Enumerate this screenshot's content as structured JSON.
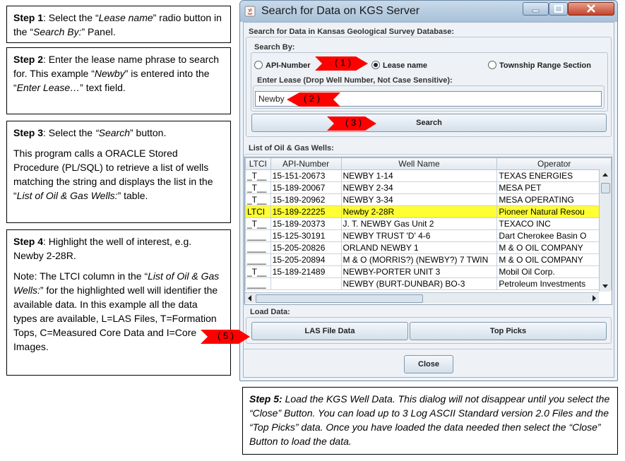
{
  "steps": {
    "s1": {
      "head": "Step 1",
      "text1": ": Select the “",
      "em1": "Lease name",
      "text2": "” radio button in the “",
      "em2": "Search By:",
      "text3": "” Panel."
    },
    "s2": {
      "head": "Step 2",
      "text1": ": Enter the lease name phrase to search for. This example “",
      "em1": "Newby",
      "text2": "” is entered into the “",
      "em2": "Enter Lease…",
      "text3": "” text field."
    },
    "s3": {
      "head": "Step 3",
      "text1": ": Select the ",
      "em1": "“Search",
      "text2": "” button.",
      "para2a": "This program calls a ORACLE Stored Procedure (PL/SQL) to retrieve a list of wells matching the string and displays the list in the “",
      "em2": "List of Oil & Gas Wells:",
      "para2b": "” table."
    },
    "s4": {
      "head": "Step 4",
      "text1": ": Highlight the well of interest, e.g. Newby 2-28R.",
      "para2a": "Note: The LTCI column in the “",
      "em2": "List of Oil & Gas Wells:",
      "para2b": "” for the highlighted well will identifier the available data. In this example all the data types are available, L=LAS Files, T=Formation Tops, C=Measured Core Data and I=Core Images."
    },
    "s5": {
      "head": "Step 5:",
      "text": " Load the KGS Well Data.  This dialog will not disappear until you select the “Close” Button.  You can load up to 3 Log ASCII Standard version 2.0 Files and the “Top Picks” data.  Once you have loaded the data needed then select the “Close” Button to load the data."
    }
  },
  "dialog": {
    "title": "Search for Data on KGS Server",
    "search_panel_title": "Search for Data in Kansas Geological Survey Database:",
    "search_by_title": "Search By:",
    "radio_api": "API-Number",
    "radio_lease": "Lease name",
    "radio_trs": "Township Range Section",
    "enter_lease_title": "Enter Lease (Drop Well Number, Not Case Sensitive):",
    "lease_value": "Newby",
    "search_button": "Search",
    "list_title": "List of Oil & Gas Wells:",
    "columns": [
      "LTCI",
      "API-Number",
      "Well Name",
      "Operator"
    ],
    "rows": [
      [
        "_T__",
        "15-151-20673",
        "NEWBY 1-14",
        "TEXAS ENERGIES"
      ],
      [
        "_T__",
        "15-189-20067",
        "NEWBY 2-34",
        "MESA PET"
      ],
      [
        "_T__",
        "15-189-20962",
        "NEWBY 3-34",
        "MESA OPERATING"
      ],
      [
        "LTCI",
        "15-189-22225",
        "Newby 2-28R",
        "Pioneer Natural Resou"
      ],
      [
        "_T__",
        "15-189-20373",
        "J. T. NEWBY Gas Unit 2",
        "TEXACO INC"
      ],
      [
        "____",
        "15-125-30191",
        "NEWBY TRUST 'D' 4-6",
        "Dart Cherokee Basin O"
      ],
      [
        "____",
        "15-205-20826",
        "ORLAND NEWBY 1",
        "M & O OIL COMPANY"
      ],
      [
        "____",
        "15-205-20894",
        "M & O (MORRIS?) (NEWBY?) 7 TWIN",
        "M & O OIL COMPANY"
      ],
      [
        "_T__",
        "15-189-21489",
        "NEWBY-PORTER UNIT 3",
        "Mobil Oil Corp."
      ],
      [
        "____",
        "",
        "NEWBY (BURT-DUNBAR) BO-3",
        "Petroleum Investments"
      ]
    ],
    "selected_row": 3,
    "load_title": "Load Data:",
    "las_button": "LAS File Data",
    "tops_button": "Top Picks",
    "close_button": "Close"
  },
  "callouts": [
    "( 1 )",
    "( 2 )",
    "( 3 )",
    "( 5 )"
  ],
  "colors": {
    "arrow": "#ff0000",
    "selected_row": "#ffff33"
  }
}
